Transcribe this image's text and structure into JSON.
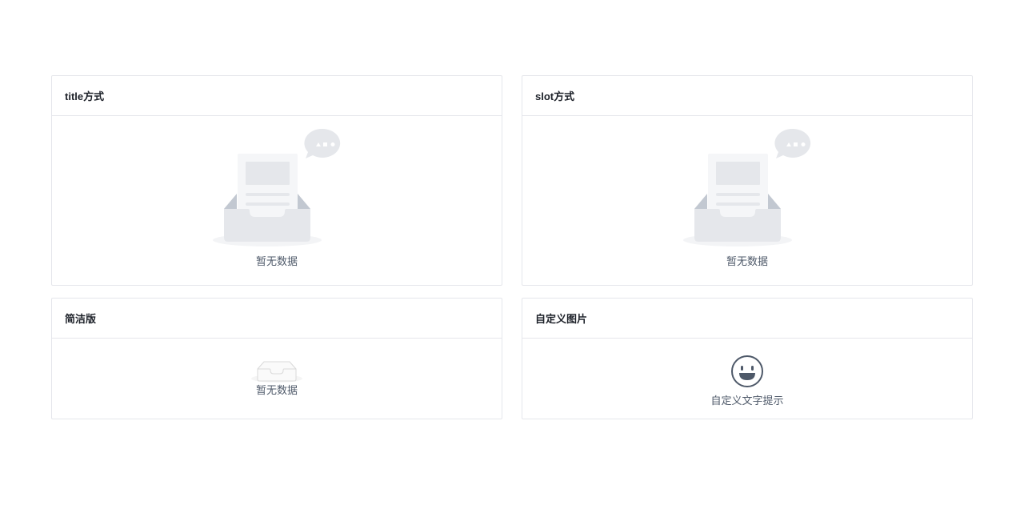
{
  "cards": [
    {
      "title": "title方式",
      "empty_text": "暂无数据"
    },
    {
      "title": "slot方式",
      "empty_text": "暂无数据"
    },
    {
      "title": "简洁版",
      "empty_text": "暂无数据"
    },
    {
      "title": "自定义图片",
      "empty_text": "自定义文字提示"
    }
  ],
  "icons": {
    "empty_large": "empty-inbox-illustration",
    "empty_simple": "empty-tray-icon",
    "custom": "smile-face-icon"
  },
  "colors": {
    "border": "#e5e6eb",
    "title": "#1d2129",
    "text": "#4e5969",
    "illustration_light": "#e5e7eb",
    "illustration_dark": "#c2c8d1"
  }
}
